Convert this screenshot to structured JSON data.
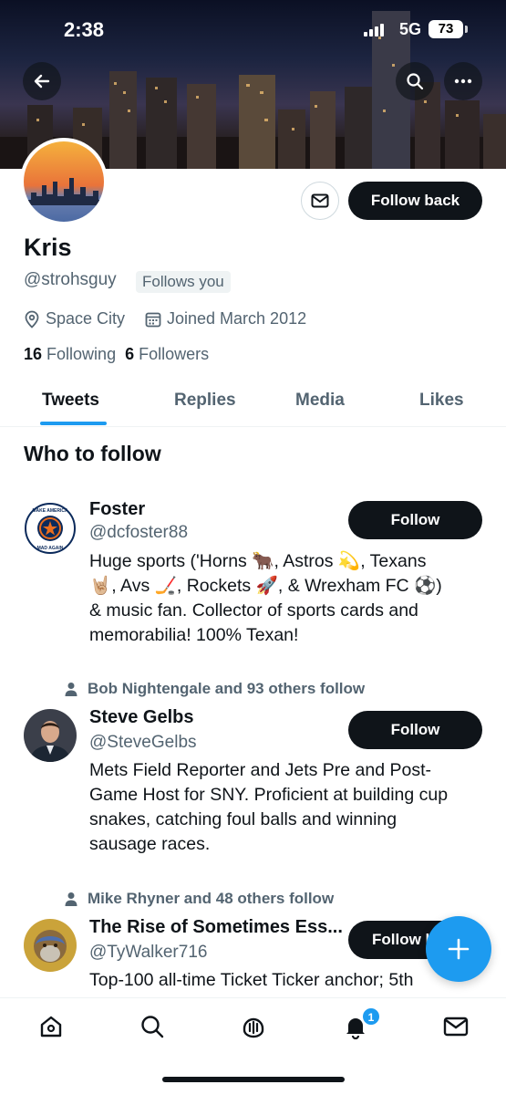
{
  "status_bar": {
    "time": "2:38",
    "network": "5G",
    "battery": "73"
  },
  "profile": {
    "name": "Kris",
    "handle": "@strohsguy",
    "follows_you": "Follows you",
    "location": "Space City",
    "joined": "Joined March 2012",
    "following_count": "16",
    "following_label": "Following",
    "followers_count": "6",
    "followers_label": "Followers",
    "follow_back_label": "Follow back"
  },
  "tabs": [
    {
      "label": "Tweets",
      "active": true
    },
    {
      "label": "Replies",
      "active": false
    },
    {
      "label": "Media",
      "active": false
    },
    {
      "label": "Likes",
      "active": false
    }
  ],
  "who_to_follow": {
    "title": "Who to follow",
    "items": [
      {
        "context": "",
        "name": "Foster",
        "handle": "@dcfoster88",
        "follow_label": "Follow",
        "bio": [
          "Huge sports ('Horns 🐂, Astros 💫, Texans",
          "🤘🏼, Avs 🏒, Rockets 🚀, & Wrexham FC ⚽)",
          "& music fan. Collector of sports cards and",
          "memorabilia! 100% Texan!"
        ],
        "avatar_text_top": "MAKE AMERICA",
        "avatar_text_bottom": "MAD AGAIN"
      },
      {
        "context": "Bob Nightengale and 93 others follow",
        "name": "Steve Gelbs",
        "handle": "@SteveGelbs",
        "follow_label": "Follow",
        "bio": [
          "Mets Field Reporter and Jets Pre and Post-",
          "Game Host for SNY. Proficient at building cup",
          "snakes, catching foul balls and winning",
          "sausage races."
        ]
      },
      {
        "context": "Mike Rhyner and 48 others follow",
        "name": "The Rise of Sometimes Ess...",
        "handle": "@TyWalker716",
        "follow_label": "Follow b",
        "bio": [
          "Top-100 all-time Ticket Ticker anchor; 5th"
        ]
      }
    ]
  },
  "notifications_badge": "1",
  "icons": {
    "back": "back-arrow-icon",
    "search": "search-icon",
    "more": "more-icon",
    "message": "mail-icon",
    "location": "location-pin-icon",
    "calendar": "calendar-icon",
    "person": "person-icon",
    "compose": "plus-icon",
    "nav": [
      "home-icon",
      "search-icon",
      "spaces-icon",
      "bell-icon",
      "mail-icon"
    ]
  },
  "colors": {
    "accent": "#1d9bf0",
    "text": "#0f1419",
    "secondary": "#536471"
  }
}
